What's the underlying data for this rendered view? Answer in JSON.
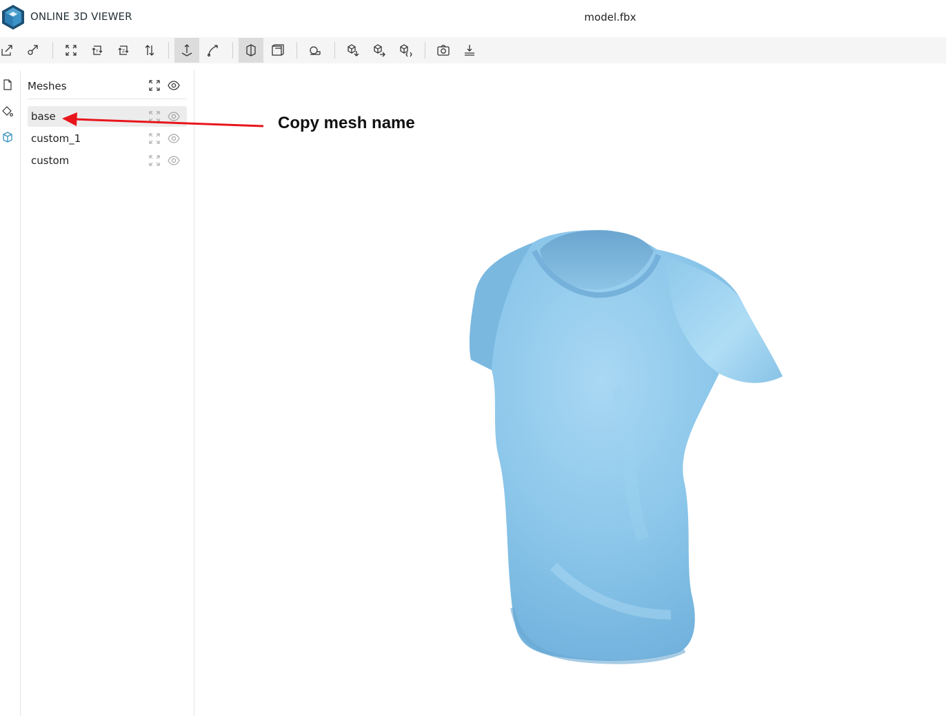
{
  "header": {
    "app_title": "ONLINE 3D VIEWER",
    "file_title": "model.fbx"
  },
  "toolbar": {
    "buttons": [
      {
        "name": "open-file-icon"
      },
      {
        "name": "open-url-icon"
      },
      {
        "name": "fit-to-window-icon"
      },
      {
        "name": "set-up-vector-y-icon"
      },
      {
        "name": "set-up-vector-z-icon"
      },
      {
        "name": "flip-up-vector-icon"
      },
      {
        "name": "fixed-up-vector-icon"
      },
      {
        "name": "free-orbit-icon"
      },
      {
        "name": "perspective-camera-icon"
      },
      {
        "name": "orthographic-camera-icon"
      },
      {
        "name": "measure-icon"
      },
      {
        "name": "export-model-icon"
      },
      {
        "name": "share-model-icon"
      },
      {
        "name": "embed-model-icon"
      },
      {
        "name": "snapshot-icon"
      },
      {
        "name": "settings-icon"
      }
    ]
  },
  "left_nav": [
    {
      "name": "files-icon"
    },
    {
      "name": "materials-icon"
    },
    {
      "name": "meshes-icon"
    }
  ],
  "panel": {
    "title": "Meshes",
    "meshes": [
      {
        "label": "base"
      },
      {
        "label": "custom_1"
      },
      {
        "label": "custom"
      }
    ]
  },
  "annotation": {
    "text": "Copy mesh name",
    "color": "#e8151b"
  },
  "colors": {
    "accent": "#3393bd",
    "shirt": "#86c3e8",
    "toolbar_bg": "#f5f5f5"
  }
}
